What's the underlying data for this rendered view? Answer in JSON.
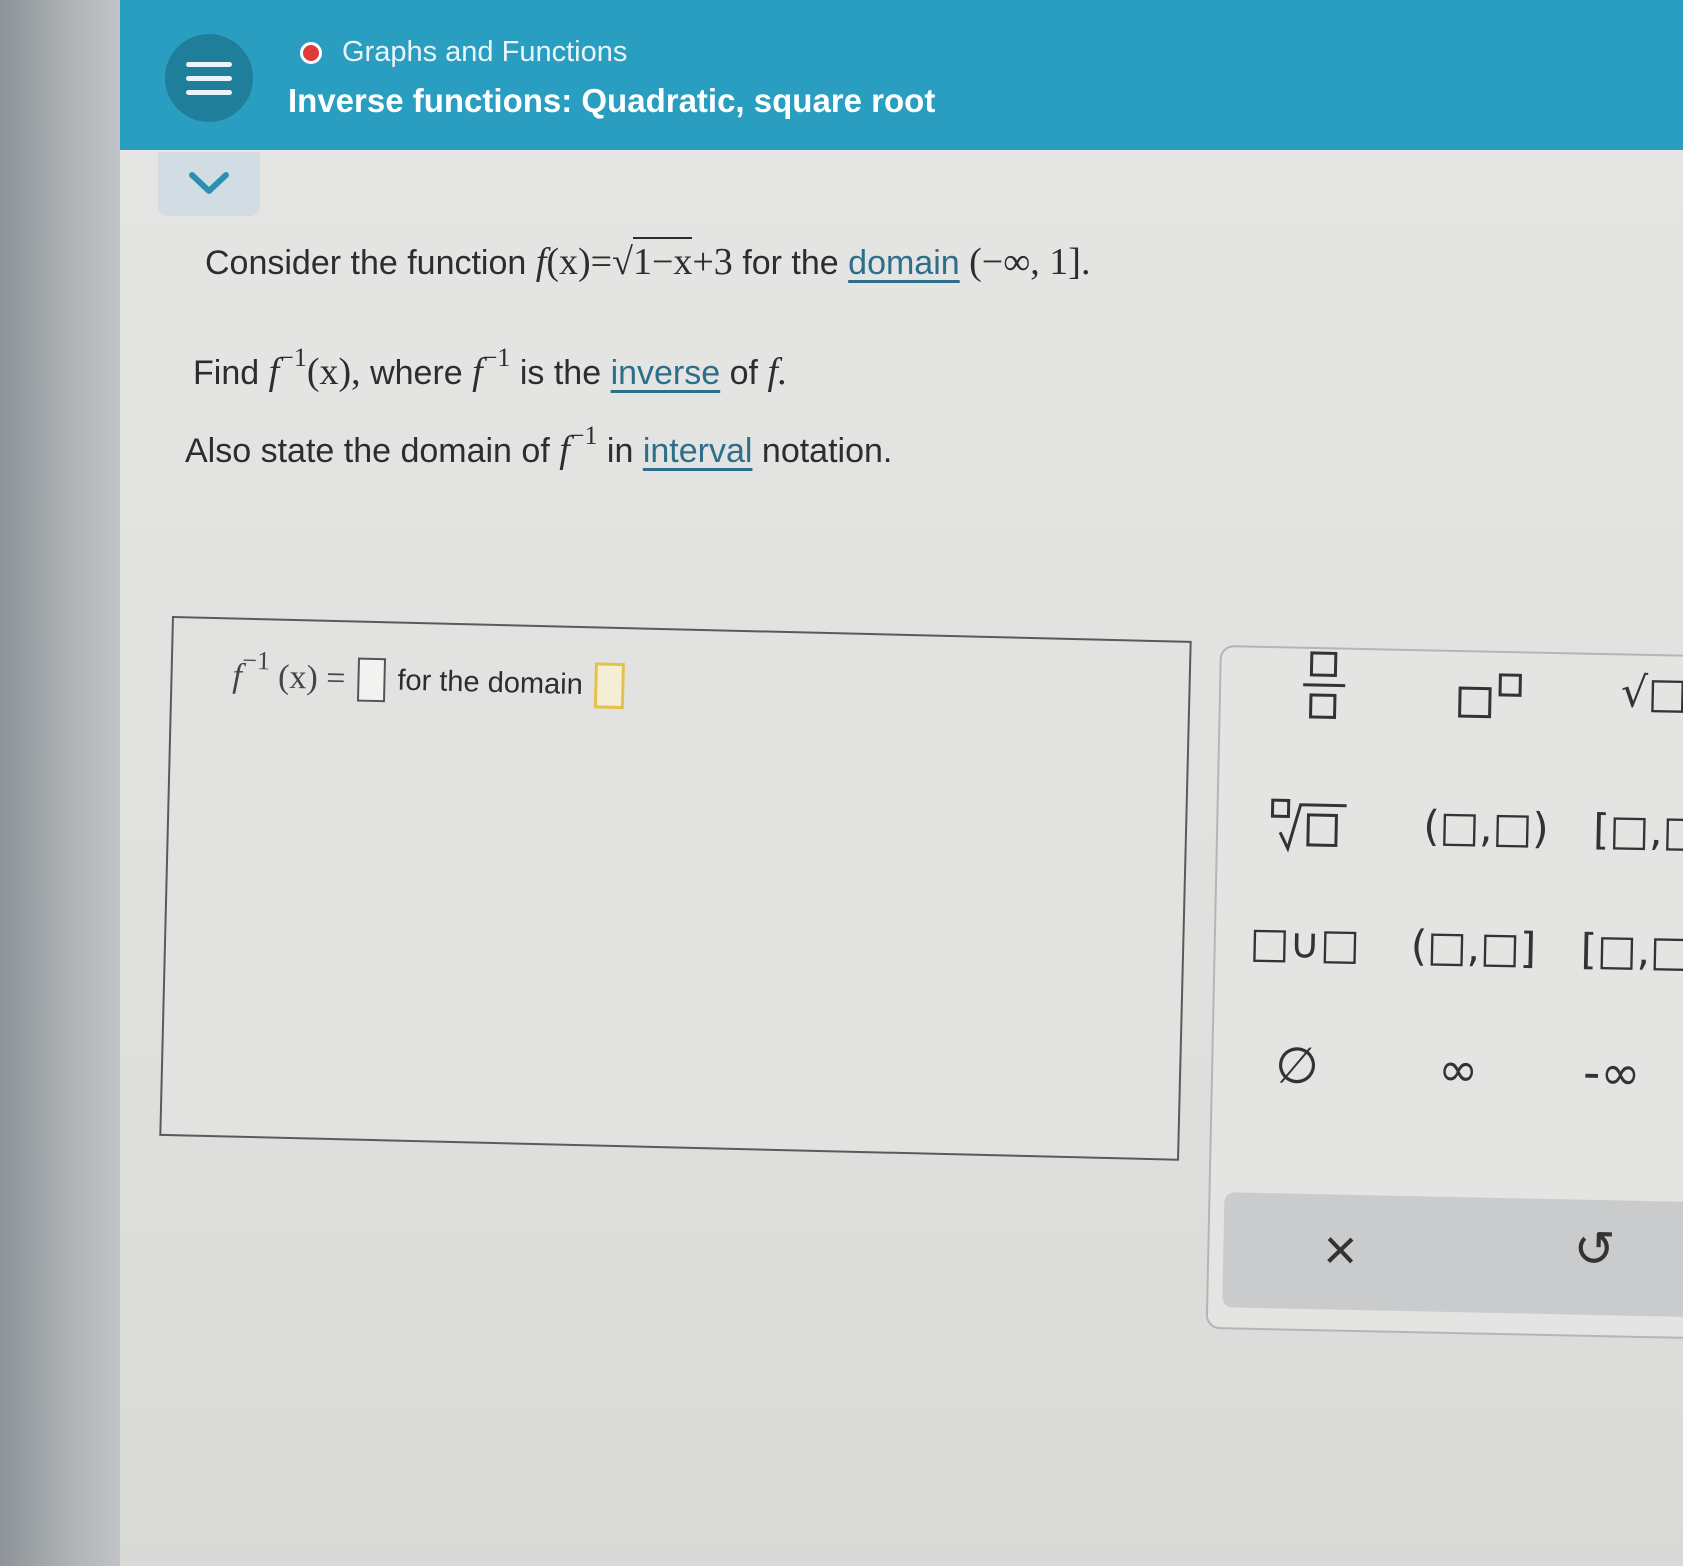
{
  "header": {
    "breadcrumb": "Graphs and Functions",
    "title": "Inverse functions: Quadratic, square root"
  },
  "question": {
    "line1_prefix": "Consider the function",
    "line1_func_name": "f",
    "line1_func_arg": "(x)",
    "line1_equals": "=",
    "line1_radicand": "1−x",
    "line1_plus": "+3",
    "line1_for": "for the",
    "line1_link_domain": "domain",
    "line1_domain_value": "(−∞, 1].",
    "line2_find": "Find",
    "line2_f": "f",
    "line2_sup": "−1",
    "line2_arg": "(x),",
    "line2_where": "where",
    "line2_f2": "f",
    "line2_sup2": "−1",
    "line2_isthe": "is the",
    "line2_link_inverse": "inverse",
    "line2_of": "of",
    "line2_f3": "f.",
    "line3_prefix": "Also state the domain of",
    "line3_f": "f",
    "line3_sup": "−1",
    "line3_in": "in",
    "line3_link_interval": "interval",
    "line3_suffix": "notation."
  },
  "answer": {
    "f": "f",
    "sup": "−1",
    "arg": "(x)",
    "equals": "=",
    "for_the_domain": "for the domain"
  },
  "palette": {
    "fraction": "□/□",
    "superscript": "□□",
    "sqrt": "√□",
    "nth_root": "□√□",
    "open_interval": "(□,□)",
    "closed_interval": "[□,□",
    "union": "□∪□",
    "half_open_right": "(□,□]",
    "half_open_left": "[□,□",
    "empty_set": "∅",
    "infinity": "∞",
    "neg_infinity": "-∞",
    "clear": "×",
    "undo": "↺"
  }
}
